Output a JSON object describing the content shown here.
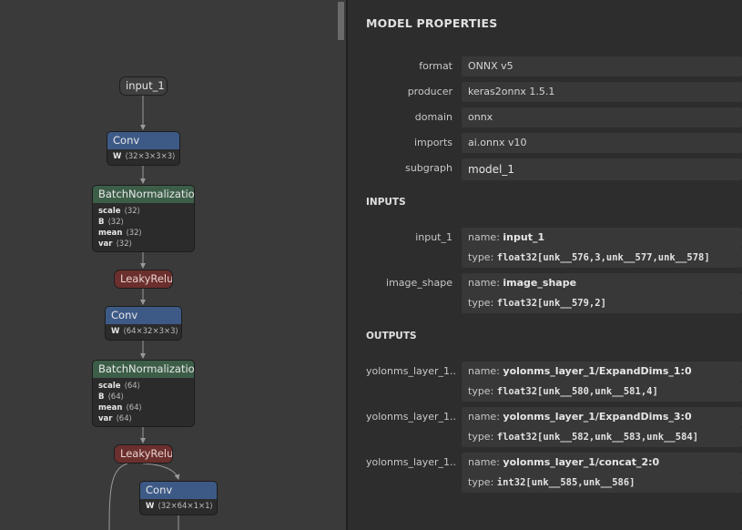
{
  "graph": {
    "nodes": {
      "input": {
        "label": "input_1"
      },
      "conv1": {
        "op": "Conv",
        "attrs": [
          {
            "name": "W",
            "value": "⟨32×3×3×3⟩"
          }
        ]
      },
      "bn1": {
        "op": "BatchNormalization",
        "attrs": [
          {
            "name": "scale",
            "value": "⟨32⟩"
          },
          {
            "name": "B",
            "value": "⟨32⟩"
          },
          {
            "name": "mean",
            "value": "⟨32⟩"
          },
          {
            "name": "var",
            "value": "⟨32⟩"
          }
        ]
      },
      "relu1": {
        "op": "LeakyRelu"
      },
      "conv2": {
        "op": "Conv",
        "attrs": [
          {
            "name": "W",
            "value": "⟨64×32×3×3⟩"
          }
        ]
      },
      "bn2": {
        "op": "BatchNormalization",
        "attrs": [
          {
            "name": "scale",
            "value": "⟨64⟩"
          },
          {
            "name": "B",
            "value": "⟨64⟩"
          },
          {
            "name": "mean",
            "value": "⟨64⟩"
          },
          {
            "name": "var",
            "value": "⟨64⟩"
          }
        ]
      },
      "relu2": {
        "op": "LeakyRelu"
      },
      "conv3": {
        "op": "Conv",
        "attrs": [
          {
            "name": "W",
            "value": "⟨32×64×1×1⟩"
          }
        ]
      }
    }
  },
  "properties": {
    "title": "MODEL PROPERTIES",
    "model": [
      {
        "label": "format",
        "value": "ONNX v5"
      },
      {
        "label": "producer",
        "value": "keras2onnx 1.5.1"
      },
      {
        "label": "domain",
        "value": "onnx"
      },
      {
        "label": "imports",
        "value": "ai.onnx v10"
      },
      {
        "label": "subgraph",
        "value": "model_1"
      }
    ],
    "inputs_title": "INPUTS",
    "inputs": [
      {
        "label": "input_1",
        "name_key": "name: ",
        "name": "input_1",
        "type_key": "type: ",
        "type": "float32[unk__576,3,unk__577,unk__578]"
      },
      {
        "label": "image_shape",
        "name_key": "name: ",
        "name": "image_shape",
        "type_key": "type: ",
        "type": "float32[unk__579,2]"
      }
    ],
    "outputs_title": "OUTPUTS",
    "outputs": [
      {
        "label": "yolonms_layer_1...",
        "name_key": "name: ",
        "name": "yolonms_layer_1/ExpandDims_1:0",
        "type_key": "type: ",
        "type": "float32[unk__580,unk__581,4]"
      },
      {
        "label": "yolonms_layer_1...",
        "name_key": "name: ",
        "name": "yolonms_layer_1/ExpandDims_3:0",
        "type_key": "type: ",
        "type": "float32[unk__582,unk__583,unk__584]"
      },
      {
        "label": "yolonms_layer_1...",
        "name_key": "name: ",
        "name": "yolonms_layer_1/concat_2:0",
        "type_key": "type: ",
        "type": "int32[unk__585,unk__586]"
      }
    ]
  }
}
